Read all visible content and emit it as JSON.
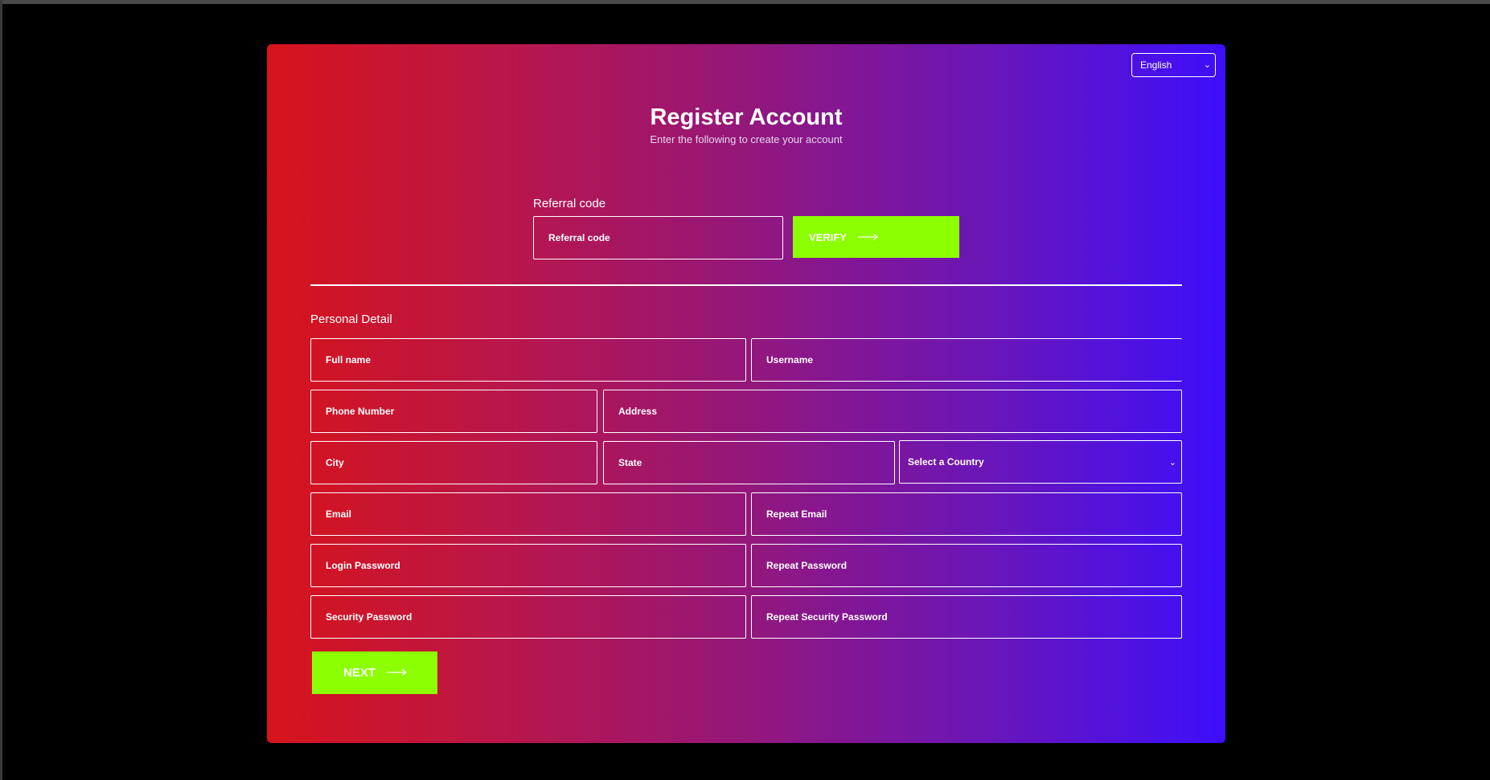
{
  "language": {
    "selected": "English"
  },
  "header": {
    "title": "Register Account",
    "subtitle": "Enter the following to create your account"
  },
  "referral": {
    "label": "Referral code",
    "placeholder": "Referral code",
    "verify_label": "VERIFY"
  },
  "personal": {
    "section_label": "Personal Detail",
    "full_name": "Full name",
    "username": "Username",
    "phone": "Phone Number",
    "address": "Address",
    "city": "City",
    "state": "State",
    "country": "Select a Country",
    "email": "Email",
    "repeat_email": "Repeat Email",
    "login_password": "Login Password",
    "repeat_password": "Repeat Password",
    "security_password": "Security Password",
    "repeat_security_password": "Repeat Security Password"
  },
  "actions": {
    "next_label": "NEXT"
  },
  "icons": {
    "arrow": "long-right-arrow-icon",
    "chevron": "chevron-down-icon"
  },
  "colors": {
    "gradient_start": "#d7141b",
    "gradient_end": "#3d0efc",
    "button": "#8cff00",
    "text": "#ffffff"
  }
}
